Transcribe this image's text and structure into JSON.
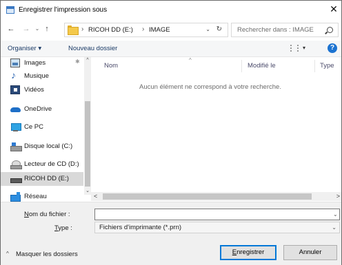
{
  "window": {
    "title": "Enregistrer l'impression sous",
    "close": "✕"
  },
  "nav": {
    "back": "←",
    "forward": "→",
    "recent": "⌄",
    "up": "↑"
  },
  "address": {
    "sep": "›",
    "drive": "RICOH DD (E:)",
    "folder": "IMAGE",
    "dropdown": "⌄",
    "refresh": "↻"
  },
  "search": {
    "placeholder": "Rechercher dans : IMAGE"
  },
  "toolbar": {
    "organize": "Organiser ▾",
    "new_folder": "Nouveau dossier",
    "view_drop": "▾",
    "help": "?"
  },
  "sidebar": {
    "items": [
      {
        "label": "Images",
        "icon": "images-icon"
      },
      {
        "label": "Musique",
        "icon": "music-icon"
      },
      {
        "label": "Vidéos",
        "icon": "videos-icon"
      },
      {
        "label": "OneDrive",
        "icon": "onedrive-icon"
      },
      {
        "label": "Ce PC",
        "icon": "pc-icon"
      },
      {
        "label": "Disque local (C:)",
        "icon": "local-disk-icon"
      },
      {
        "label": "Lecteur de CD (D:)",
        "icon": "cd-drive-icon"
      },
      {
        "label": "RICOH DD (E:)",
        "icon": "usb-drive-icon",
        "selected": true
      },
      {
        "label": "Réseau",
        "icon": "network-icon"
      }
    ],
    "pin": "✱",
    "scroll_up": "^",
    "scroll_down": "⌄"
  },
  "content": {
    "columns": {
      "name": "Nom",
      "modified": "Modifié le",
      "type": "Type"
    },
    "sort_caret": "^",
    "empty_message": "Aucun élément ne correspond à votre recherche."
  },
  "hscroll": {
    "left": "<",
    "right": ">"
  },
  "form": {
    "filename_label_u": "N",
    "filename_label_rest": "om du fichier :",
    "filename_value": "",
    "filename_drop": "⌄",
    "filetype_label_u": "T",
    "filetype_label_rest": "ype :",
    "filetype_value": "Fichiers d'imprimante (*.prn)",
    "filetype_drop": "⌄"
  },
  "footer": {
    "hide_caret": "^",
    "hide_folders": "Masquer les dossiers",
    "save_u": "E",
    "save_rest": "nregistrer",
    "cancel": "Annuler"
  },
  "colors": {
    "accent": "#0078d7",
    "selected_bg": "#d9d9d9",
    "help": "#1c73d1"
  }
}
